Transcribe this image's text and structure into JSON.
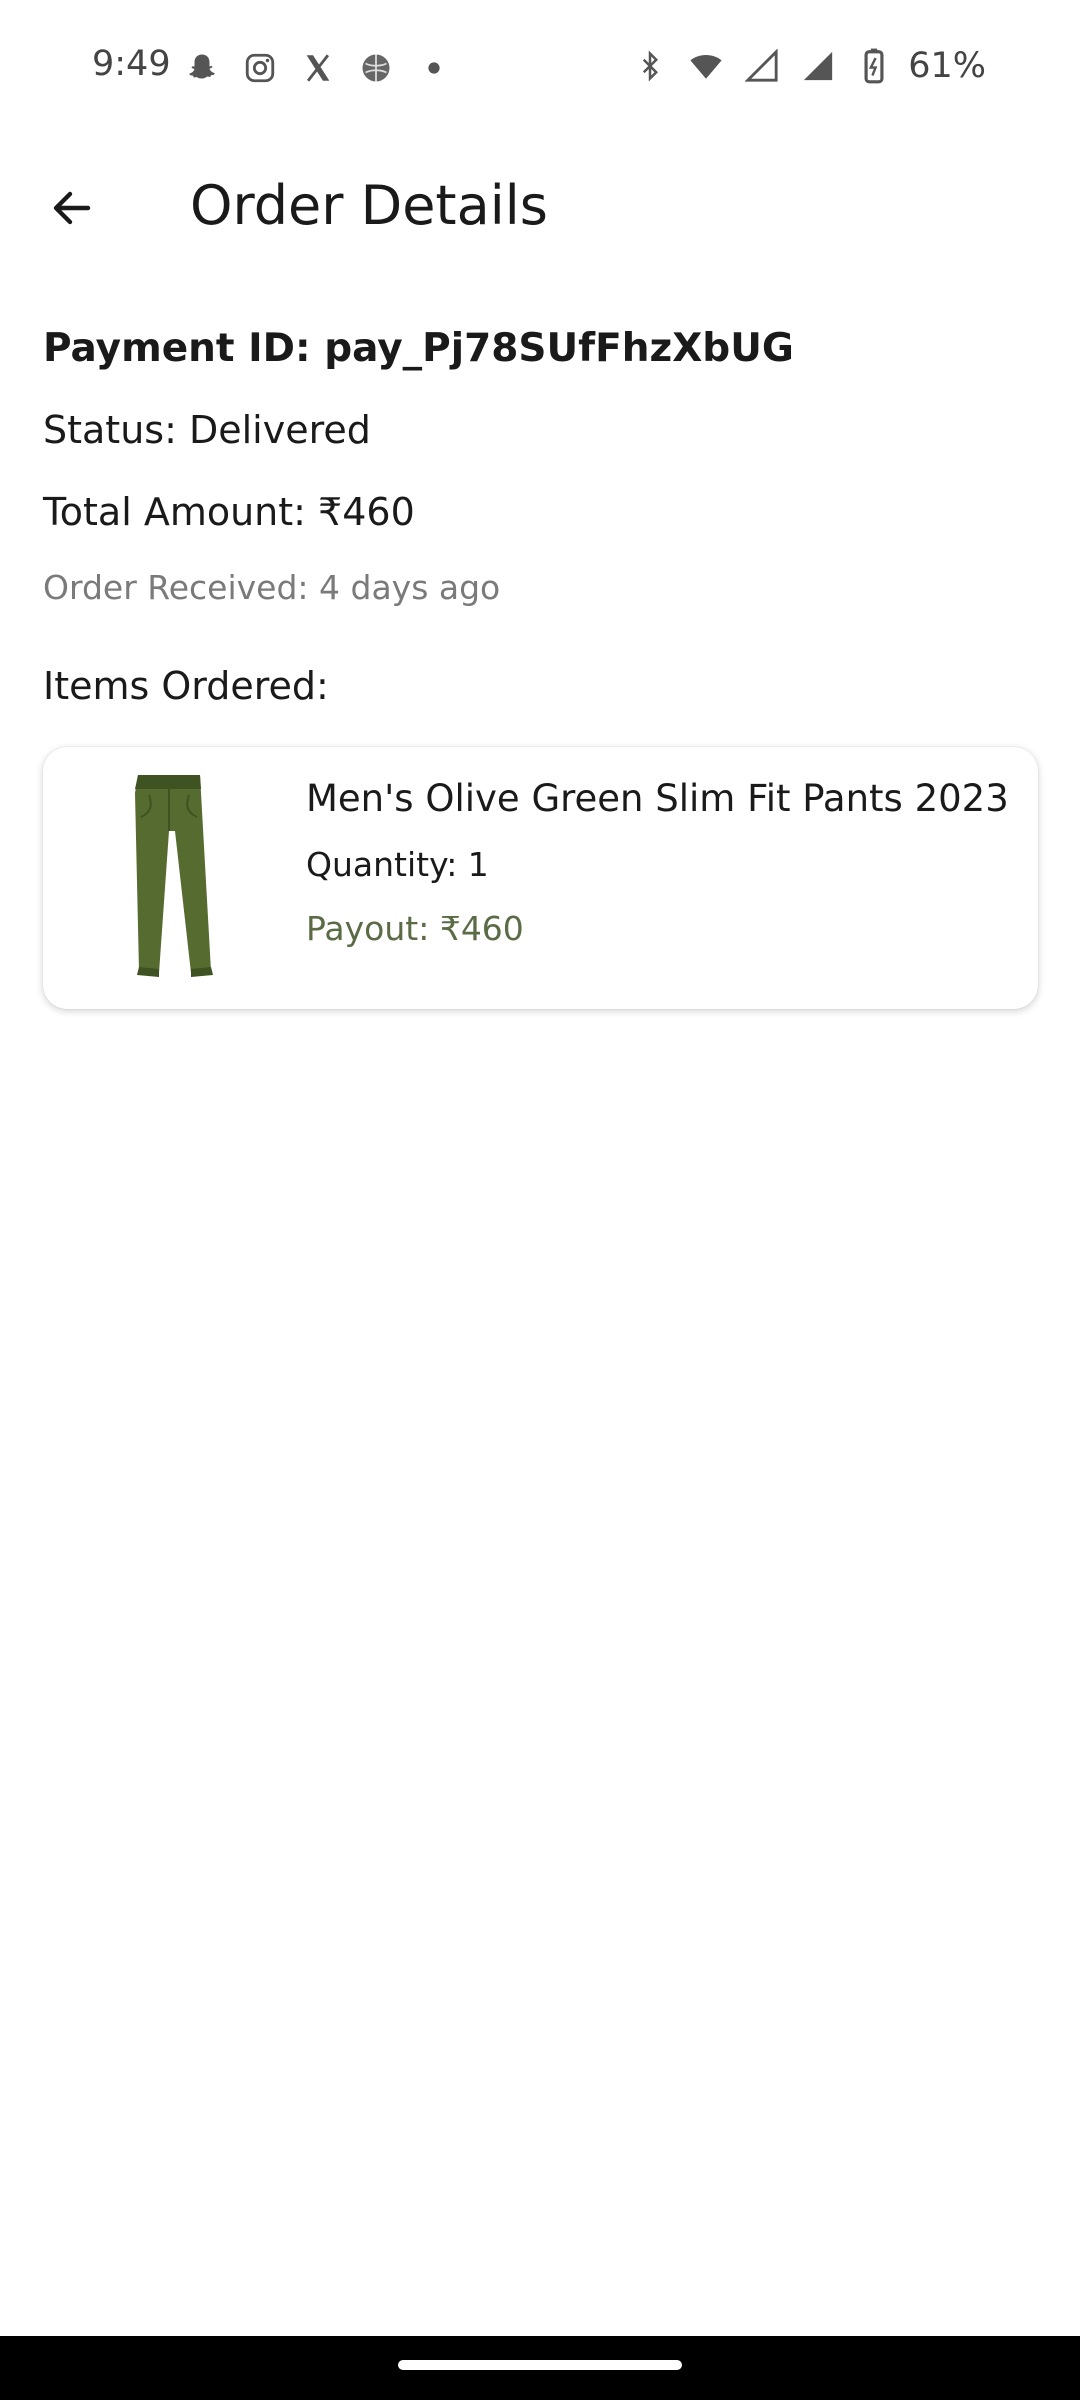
{
  "status_bar": {
    "time": "9:49",
    "battery": "61%",
    "left_icons": [
      "snapchat-icon",
      "instagram-icon",
      "x-icon",
      "globe-icon",
      "dot-icon"
    ],
    "right_icons": [
      "bluetooth-icon",
      "wifi-icon",
      "signal-icon",
      "signal-icon",
      "battery-icon"
    ]
  },
  "header": {
    "title": "Order Details"
  },
  "order": {
    "payment_id": "Payment ID: pay_Pj78SUfFhzXbUG",
    "status": "Status: Delivered",
    "total_amount": "Total Amount: ₹460",
    "received": "Order Received: 4 days ago",
    "items_heading": "Items Ordered:"
  },
  "items": [
    {
      "name": "Men's Olive Green Slim Fit Pants 2023",
      "quantity": "Quantity: 1",
      "payout": "Payout: ₹460"
    }
  ],
  "colors": {
    "payout": "#5b6b45",
    "pants": "#556b2f"
  }
}
